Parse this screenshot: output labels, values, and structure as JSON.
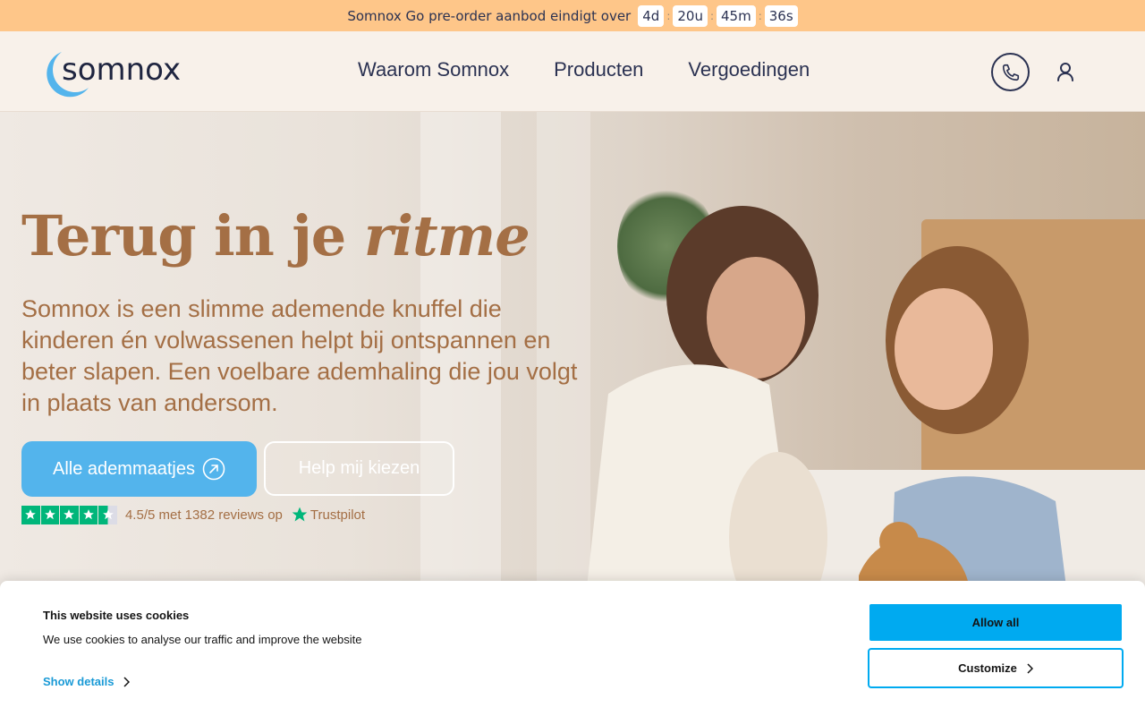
{
  "promo": {
    "text": "Somnox Go pre-order aanbod eindigt over",
    "countdown": [
      "4d",
      "20u",
      "45m",
      "36s"
    ],
    "separator": ":"
  },
  "header": {
    "logo_text": "somnox",
    "nav": [
      "Waarom Somnox",
      "Producten",
      "Vergoedingen"
    ],
    "icons": [
      "phone-icon",
      "account-icon"
    ]
  },
  "hero": {
    "title_plain": "Terug in je ",
    "title_emph": "ritme",
    "body": "Somnox is een slimme ademende knuffel die kinderen én volwassenen helpt bij ontspannen en beter slapen. Een voelbare ademhaling die jou volgt in plaats van andersom.",
    "primary_cta": "Alle ademmaatjes",
    "secondary_cta": "Help mij kiezen",
    "rating": {
      "stars": 4.5,
      "text": "4.5/5 met 1382 reviews op",
      "provider": "Trustpilot"
    }
  },
  "cookie": {
    "title": "This website uses cookies",
    "text": "We use cookies to analyse our traffic and improve the website",
    "details_link": "Show details",
    "allow_all": "Allow all",
    "customize": "Customize"
  },
  "colors": {
    "promo_bg": "#fec689",
    "header_bg": "#f8f1ea",
    "brand_text": "#a46f45",
    "navy": "#2b3252",
    "cta_blue": "#53b4ec",
    "cookie_blue": "#00aaf0",
    "trustpilot_green": "#00b67a"
  }
}
